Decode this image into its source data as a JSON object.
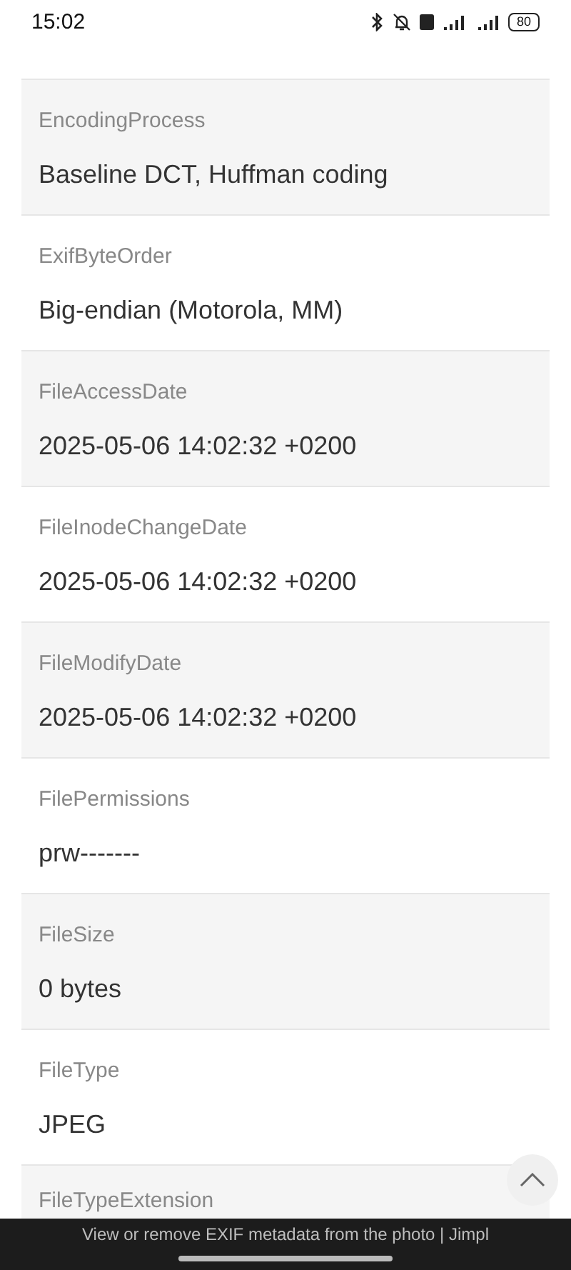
{
  "status_bar": {
    "time": "15:02",
    "battery": "80"
  },
  "fields": [
    {
      "label": "EncodingProcess",
      "value": "Baseline DCT, Huffman coding"
    },
    {
      "label": "ExifByteOrder",
      "value": "Big-endian (Motorola, MM)"
    },
    {
      "label": "FileAccessDate",
      "value": "2025-05-06 14:02:32 +0200"
    },
    {
      "label": "FileInodeChangeDate",
      "value": "2025-05-06 14:02:32 +0200"
    },
    {
      "label": "FileModifyDate",
      "value": "2025-05-06 14:02:32 +0200"
    },
    {
      "label": "FilePermissions",
      "value": "prw-------"
    },
    {
      "label": "FileSize",
      "value": "0 bytes"
    },
    {
      "label": "FileType",
      "value": "JPEG"
    },
    {
      "label": "FileTypeExtension"
    }
  ],
  "page_title": "View or remove EXIF metadata from the photo | Jimpl"
}
